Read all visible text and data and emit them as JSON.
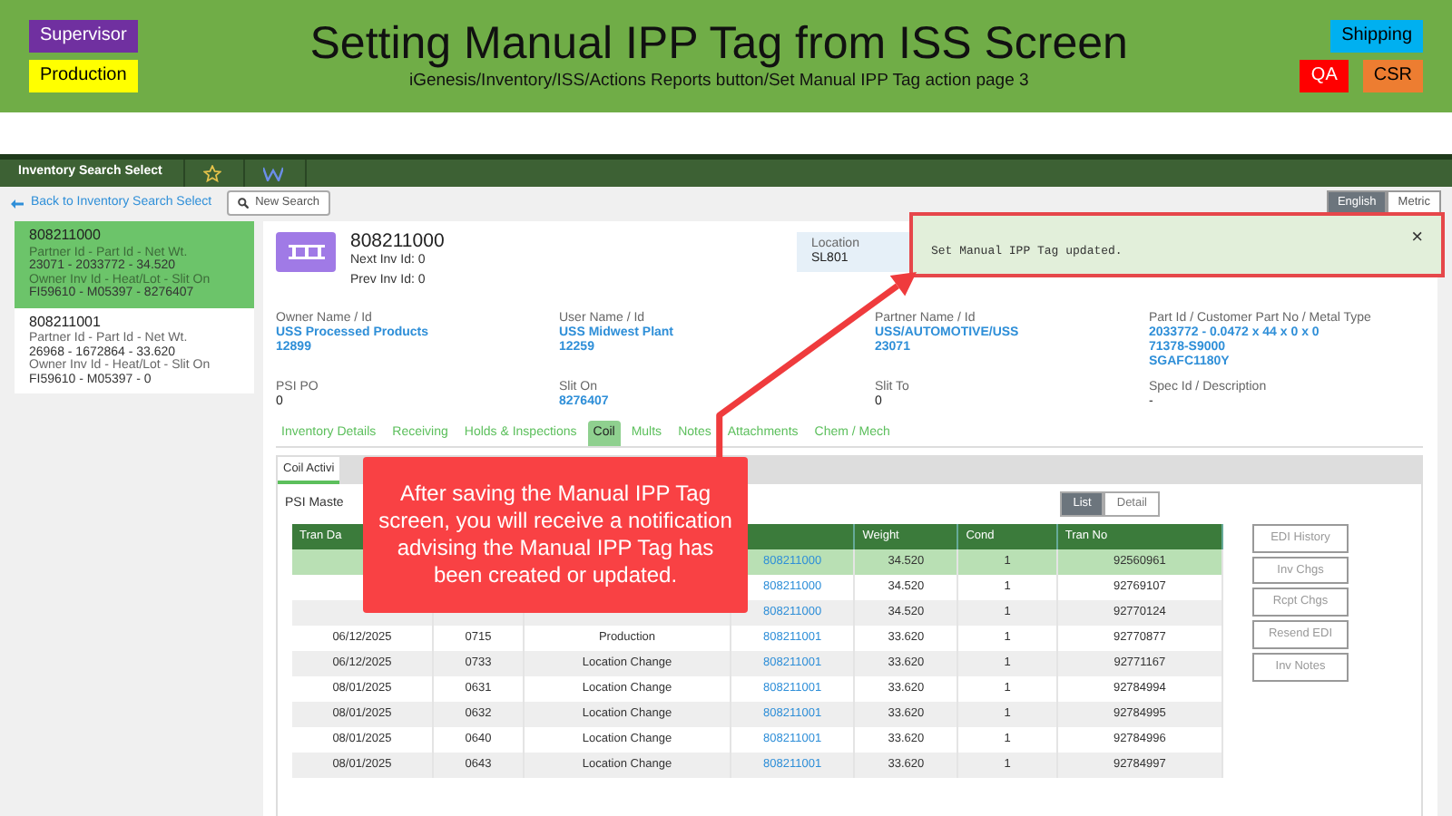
{
  "slide": {
    "title": "Setting Manual IPP Tag from ISS Screen",
    "subtitle": "iGenesis/Inventory/ISS/Actions Reports button/Set Manual IPP Tag action page 3",
    "roles_left": [
      {
        "label": "Supervisor",
        "color": "#7030a0"
      },
      {
        "label": "Production",
        "color": "#ffff00"
      }
    ],
    "roles_right": [
      {
        "label": "Shipping",
        "color": "#00b0f0"
      },
      {
        "label": "QA",
        "color": "#ff0000"
      },
      {
        "label": "CSR",
        "color": "#ed7d31"
      }
    ]
  },
  "app": {
    "title": "Inventory Search Select",
    "back_link": "Back to Inventory Search Select",
    "new_search": "New Search",
    "units": [
      {
        "label": "English",
        "selected": true
      },
      {
        "label": "Metric",
        "selected": false
      }
    ]
  },
  "inventory_list": [
    {
      "id": "808211000",
      "label1": "Partner Id - Part Id - Net Wt.",
      "value1": "23071 - 2033772 - 34.520",
      "label2": "Owner Inv Id - Heat/Lot - Slit On",
      "value2": "FI59610 - M05397 - 8276407",
      "selected": true
    },
    {
      "id": "808211001",
      "label1": "Partner Id - Part Id - Net Wt.",
      "value1": "26968 - 1672864 - 33.620",
      "label2": "Owner Inv Id - Heat/Lot - Slit On",
      "value2": "FI59610 - M05397 - 0",
      "selected": false
    }
  ],
  "detail": {
    "id": "808211000",
    "next_inv": "Next Inv Id:  0",
    "prev_inv": "Prev Inv Id:  0",
    "info": [
      {
        "label": "Location",
        "value": "SL801"
      }
    ],
    "fields": [
      {
        "label": "Owner Name / Id",
        "values": [
          "USS Processed Products",
          "12899"
        ],
        "link": true
      },
      {
        "label": "User Name / Id",
        "values": [
          "USS Midwest Plant",
          "12259"
        ],
        "link": true
      },
      {
        "label": "Partner Name / Id",
        "values": [
          "USS/AUTOMOTIVE/USS",
          "23071"
        ],
        "link": true
      },
      {
        "label": "Part Id / Customer Part No / Metal Type",
        "values": [
          "2033772 - 0.0472 x 44 x 0 x 0",
          "71378-S9000",
          "SGAFC1180Y"
        ],
        "link": true
      },
      {
        "label": "PSI PO",
        "values": [
          "0"
        ],
        "link": false
      },
      {
        "label": "Slit On",
        "values": [
          "8276407"
        ],
        "link": true
      },
      {
        "label": "Slit To",
        "values": [
          "0"
        ],
        "link": false
      },
      {
        "label": "Spec Id / Description",
        "values": [
          "-"
        ],
        "link": false
      }
    ],
    "tabs": [
      {
        "label": "Inventory Details",
        "selected": false
      },
      {
        "label": "Receiving",
        "selected": false
      },
      {
        "label": "Holds & Inspections",
        "selected": false
      },
      {
        "label": "Coil",
        "selected": true
      },
      {
        "label": "Mults",
        "selected": false
      },
      {
        "label": "Notes",
        "selected": false
      },
      {
        "label": "Attachments",
        "selected": false
      },
      {
        "label": "Chem / Mech",
        "selected": false
      }
    ],
    "subtabs": [
      {
        "label": "Coil Activi",
        "selected": true
      }
    ],
    "section_label": "PSI Maste",
    "views": [
      {
        "label": "List",
        "selected": true
      },
      {
        "label": "Detail",
        "selected": false
      }
    ],
    "table": {
      "columns": [
        "Tran Da",
        "Weight",
        "Cond",
        "Tran No"
      ],
      "rows": [
        {
          "inv_id": "808211000",
          "weight": "34.520",
          "cond": "1",
          "tran_no": "92560961",
          "selected": true
        },
        {
          "inv_id": "808211000",
          "weight": "34.520",
          "cond": "1",
          "tran_no": "92769107",
          "selected": false
        },
        {
          "inv_id": "808211000",
          "weight": "34.520",
          "cond": "1",
          "tran_no": "92770124",
          "selected": false
        },
        {
          "date": "06/12/2025",
          "code": "0715",
          "activity": "Production",
          "inv_id": "808211001",
          "weight": "33.620",
          "cond": "1",
          "tran_no": "92770877",
          "selected": false
        },
        {
          "date": "06/12/2025",
          "code": "0733",
          "activity": "Location Change",
          "inv_id": "808211001",
          "weight": "33.620",
          "cond": "1",
          "tran_no": "92771167",
          "selected": false
        },
        {
          "date": "08/01/2025",
          "code": "0631",
          "activity": "Location Change",
          "inv_id": "808211001",
          "weight": "33.620",
          "cond": "1",
          "tran_no": "92784994",
          "selected": false
        },
        {
          "date": "08/01/2025",
          "code": "0632",
          "activity": "Location Change",
          "inv_id": "808211001",
          "weight": "33.620",
          "cond": "1",
          "tran_no": "92784995",
          "selected": false
        },
        {
          "date": "08/01/2025",
          "code": "0640",
          "activity": "Location Change",
          "inv_id": "808211001",
          "weight": "33.620",
          "cond": "1",
          "tran_no": "92784996",
          "selected": false
        },
        {
          "date": "08/01/2025",
          "code": "0643",
          "activity": "Location Change",
          "inv_id": "808211001",
          "weight": "33.620",
          "cond": "1",
          "tran_no": "92784997",
          "selected": false
        }
      ]
    },
    "side_buttons": [
      {
        "label": "EDI History",
        "disabled": true
      },
      {
        "label": "Inv Chgs",
        "disabled": true
      },
      {
        "label": "Rcpt Chgs",
        "disabled": true
      },
      {
        "label": "Resend EDI",
        "disabled": true
      },
      {
        "label": "Inv Notes",
        "disabled": true
      }
    ]
  },
  "toast": {
    "message": "Set Manual IPP Tag updated.",
    "close": "×"
  },
  "callout": {
    "text": "After saving the Manual IPP Tag screen, you will receive a notification advising the Manual IPP Tag has been created or updated."
  }
}
